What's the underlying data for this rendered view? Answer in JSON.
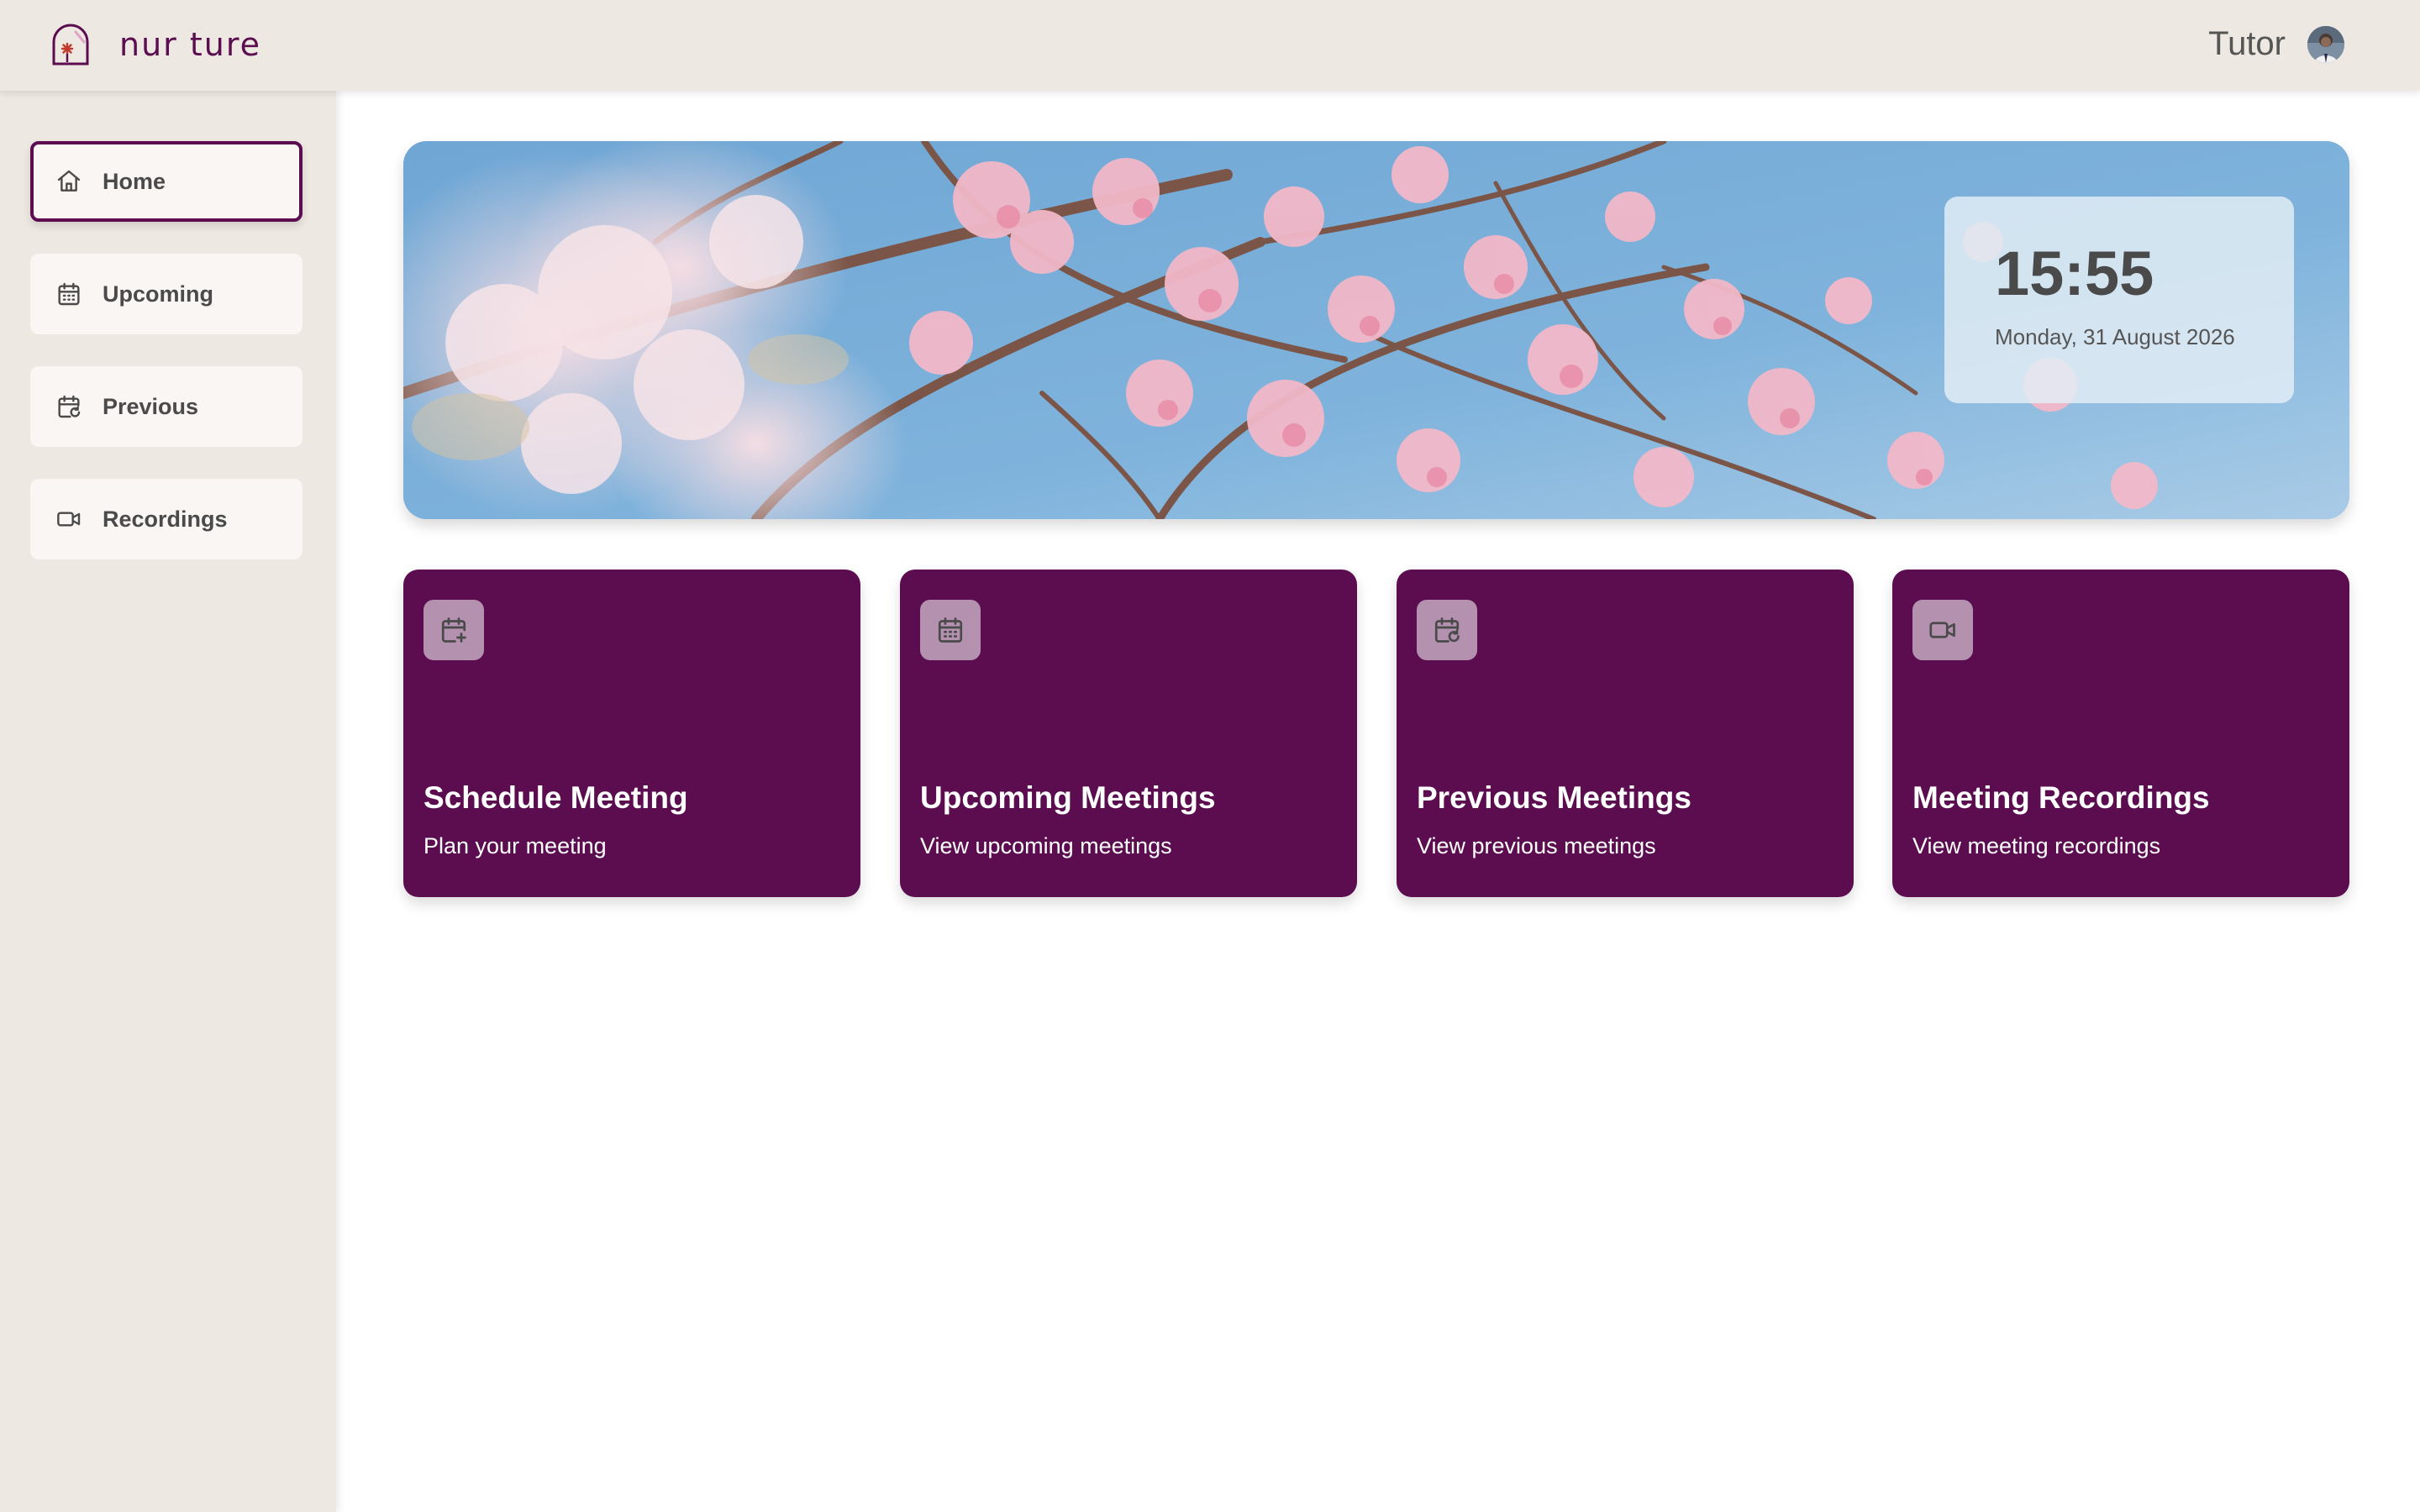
{
  "app": {
    "brand_name": "nur ture",
    "logo_icon": "nurture-logo-icon",
    "role_label": "Tutor",
    "avatar_icon": "user-avatar"
  },
  "colors": {
    "primary": "#5b0d50",
    "chrome": "#ede8e1",
    "nav_item_bg": "#f9f6f3",
    "sky": "#7fb2d9"
  },
  "sidebar": {
    "items": [
      {
        "label": "Home",
        "icon": "home-icon",
        "active": true
      },
      {
        "label": "Upcoming",
        "icon": "calendar-icon",
        "active": false
      },
      {
        "label": "Previous",
        "icon": "calendar-refresh-icon",
        "active": false
      },
      {
        "label": "Recordings",
        "icon": "video-icon",
        "active": false
      }
    ]
  },
  "hero": {
    "image": "cherry-blossom-banner",
    "time": "15:55",
    "date": "Monday, 31 August 2026"
  },
  "cards": [
    {
      "title": "Schedule Meeting",
      "subtitle": "Plan your meeting",
      "icon": "calendar-plus-icon"
    },
    {
      "title": "Upcoming Meetings",
      "subtitle": "View upcoming meetings",
      "icon": "calendar-icon"
    },
    {
      "title": "Previous Meetings",
      "subtitle": "View previous meetings",
      "icon": "calendar-refresh-icon"
    },
    {
      "title": "Meeting Recordings",
      "subtitle": "View meeting recordings",
      "icon": "video-icon"
    }
  ]
}
